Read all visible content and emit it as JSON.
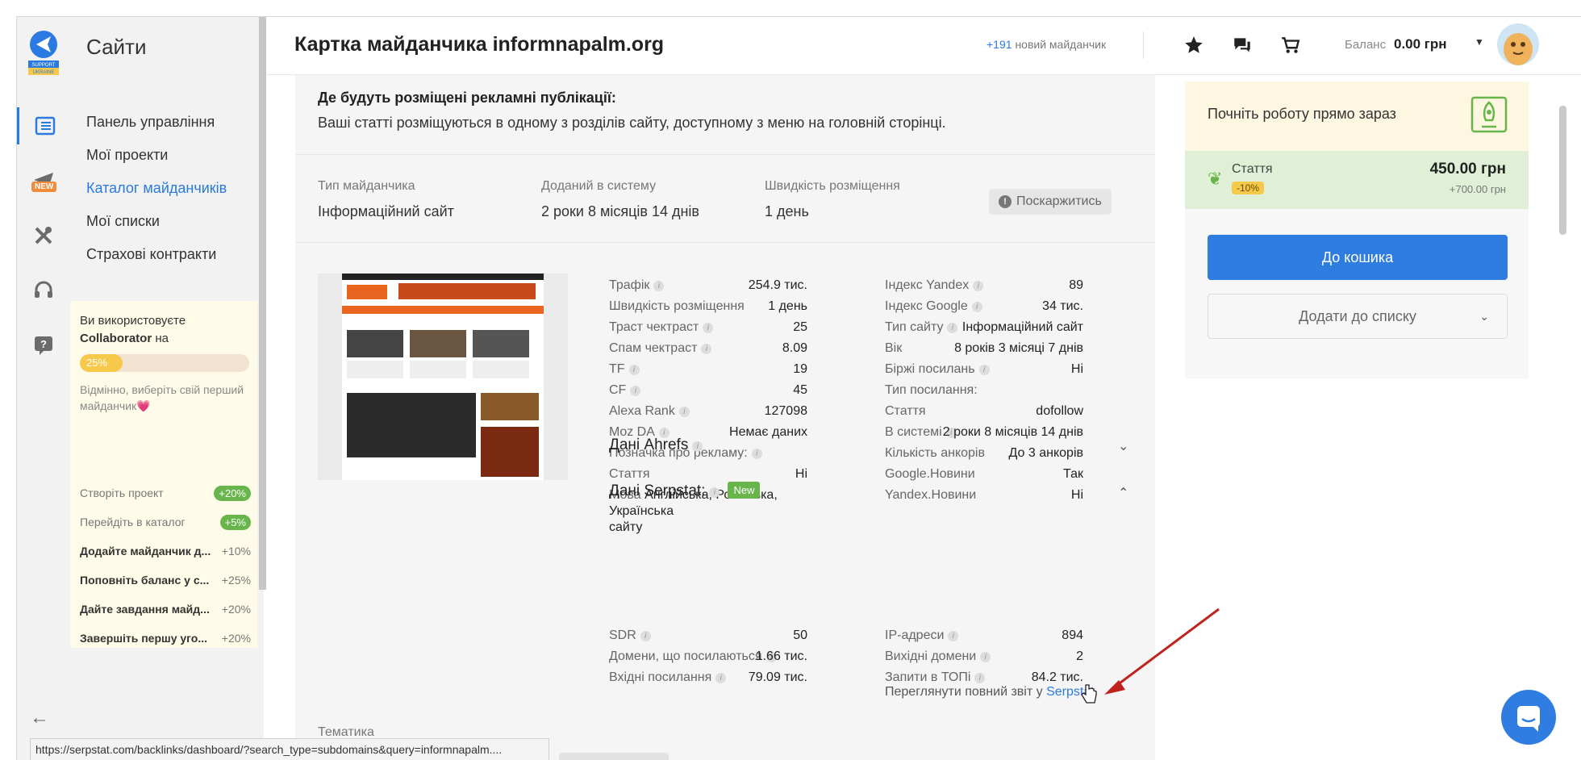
{
  "app": {
    "section_title": "Сайти",
    "logo_text": "SUPPORT UKRAINE",
    "new_badge": "NEW"
  },
  "sidebar": {
    "items": [
      {
        "label": "Панель управління",
        "active": false
      },
      {
        "label": "Мої проекти",
        "active": false
      },
      {
        "label": "Каталог майданчиків",
        "active": true
      },
      {
        "label": "Мої списки",
        "active": false
      },
      {
        "label": "Страхові контракти",
        "active": false
      }
    ],
    "collab": {
      "line1": "Ви використовуєте",
      "brand": "Collaborator",
      "line1_tail": "на",
      "progress_label": "25%",
      "progress": 0.25,
      "hint": "Відмінно, виберіть свій перший майданчик💗",
      "tasks": [
        {
          "label": "Створіть проект",
          "points": "+20%",
          "done": true
        },
        {
          "label": "Перейдіть в каталог",
          "points": "+5%",
          "done": true
        },
        {
          "label": "Додайте майданчик д...",
          "points": "+10%",
          "done": false
        },
        {
          "label": "Поповніть баланс у с...",
          "points": "+25%",
          "done": false
        },
        {
          "label": "Дайте завдання майд...",
          "points": "+20%",
          "done": false
        },
        {
          "label": "Завершіть першу уго...",
          "points": "+20%",
          "done": false
        }
      ]
    }
  },
  "header": {
    "title": "Картка майданчика informnapalm.org",
    "new_count": "+191",
    "new_text": "новий майданчик",
    "balance_label": "Баланс",
    "balance_value": "0.00 грн"
  },
  "main": {
    "placement_q": "Де будуть розміщені рекламні публікації:",
    "placement_a": "Ваші статті розміщуються в одному з розділів сайту, доступному з меню на головній сторінці.",
    "meta": [
      {
        "label": "Тип майданчика",
        "value": "Інформаційний сайт"
      },
      {
        "label": "Доданий в систему",
        "value": "2 роки 8 місяців 14 днів"
      },
      {
        "label": "Швидкість розміщення",
        "value": "1 день"
      }
    ],
    "complain_label": "Поскаржитись",
    "stats_left": [
      {
        "key": "Трафік",
        "info": true,
        "value": "254.9 тис."
      },
      {
        "key": "Швидкість розміщення",
        "info": false,
        "value": "1 день"
      },
      {
        "key": "Траст чектраст",
        "info": true,
        "value": "25"
      },
      {
        "key": "Спам чектраст",
        "info": true,
        "value": "8.09"
      },
      {
        "key": "TF",
        "info": true,
        "value": "19"
      },
      {
        "key": "CF",
        "info": true,
        "value": "45"
      },
      {
        "key": "Alexa Rank",
        "info": true,
        "value": "127098"
      },
      {
        "key": "Moz DA",
        "info": true,
        "value": "Немає даних"
      },
      {
        "key": "Позначка про рекламу:",
        "info": true,
        "value": ""
      },
      {
        "key": "Стаття",
        "info": false,
        "value": "Ні"
      }
    ],
    "language_key": "Мова",
    "language_value": "Англійська, Російська, Українська",
    "language_value2": "сайту",
    "stats_right": [
      {
        "key": "Індекс Yandex",
        "info": true,
        "value": "89"
      },
      {
        "key": "Індекс Google",
        "info": true,
        "value": "34 тис."
      },
      {
        "key": "Тип сайту",
        "info": true,
        "value": "Інформаційний сайт"
      },
      {
        "key": "Вік",
        "info": false,
        "value": "8 років 3 місяці 7 днів"
      },
      {
        "key": "Біржі посилань",
        "info": true,
        "value": "Ні"
      },
      {
        "key": "Тип посилання:",
        "info": false,
        "value": ""
      },
      {
        "key": "Стаття",
        "info": false,
        "value": "dofollow"
      },
      {
        "key": "В системі",
        "info": true,
        "value": "2 роки 8 місяців 14 днів"
      },
      {
        "key": "Кількість анкорів",
        "info": false,
        "value": "До 3 анкорів"
      },
      {
        "key": "Google.Новини",
        "info": false,
        "value": "Так"
      },
      {
        "key": "Yandex.Новини",
        "info": false,
        "value": "Ні"
      }
    ],
    "ahrefs_title": "Дані Ahrefs",
    "serpstat_title": "Дані Serpstat:",
    "serpstat_new": "New",
    "serp_left": [
      {
        "key": "SDR",
        "info": true,
        "value": "50"
      },
      {
        "key": "Домени, що посилаються",
        "info": true,
        "value": "1.66 тис."
      },
      {
        "key": "Вхідні посилання",
        "info": true,
        "value": "79.09 тис."
      }
    ],
    "serp_right": [
      {
        "key": "IP-адреси",
        "info": true,
        "value": "894"
      },
      {
        "key": "Вихідні домени",
        "info": true,
        "value": "2"
      },
      {
        "key": "Запити в ТОПі",
        "info": true,
        "value": "84.2 тис."
      }
    ],
    "report_text": "Переглянути повний звіт у",
    "report_link": "Serpstat",
    "theme_label": "Тематика"
  },
  "right": {
    "start_text": "Почніть роботу прямо зараз",
    "article_label": "Стаття",
    "discount": "-10%",
    "price": "450.00 грн",
    "old_price": "+700.00 грн",
    "cart_button": "До кошика",
    "list_button": "Додати до списку"
  },
  "status_url": "https://serpstat.com/backlinks/dashboard/?search_type=subdomains&query=informnapalm....",
  "colors": {
    "accent": "#2f7de1",
    "green": "#67b54b",
    "yellow": "#f6c94a"
  }
}
